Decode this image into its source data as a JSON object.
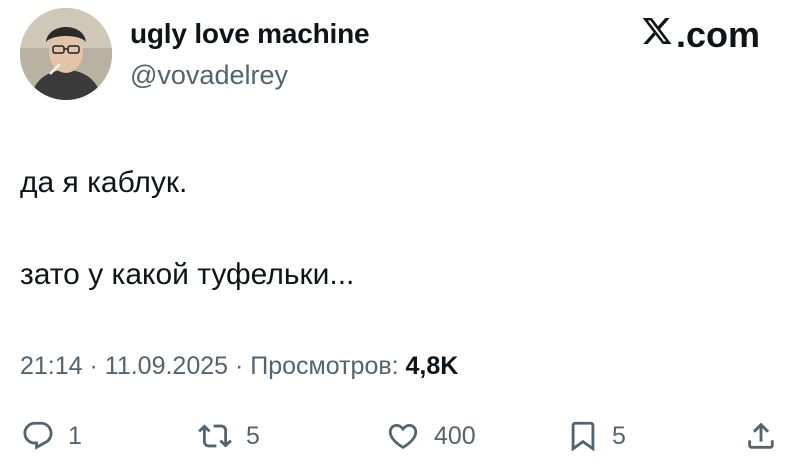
{
  "header": {
    "display_name": "ugly love machine",
    "handle": "@vovadelrey",
    "brand": ".com",
    "brand_icon": "x-logo-icon"
  },
  "tweet": {
    "line1": "да я каблук.",
    "line2": "зато у какой туфельки..."
  },
  "meta": {
    "time": "21:14",
    "sep1": " · ",
    "date": "11.09.2025",
    "sep2": " · ",
    "views_label": "Просмотров: ",
    "views_count": "4,8K"
  },
  "actions": {
    "replies": "1",
    "reposts": "5",
    "likes": "400",
    "bookmarks": "5"
  },
  "colors": {
    "text": "#0f1419",
    "secondary": "#536471",
    "background": "#ffffff"
  }
}
